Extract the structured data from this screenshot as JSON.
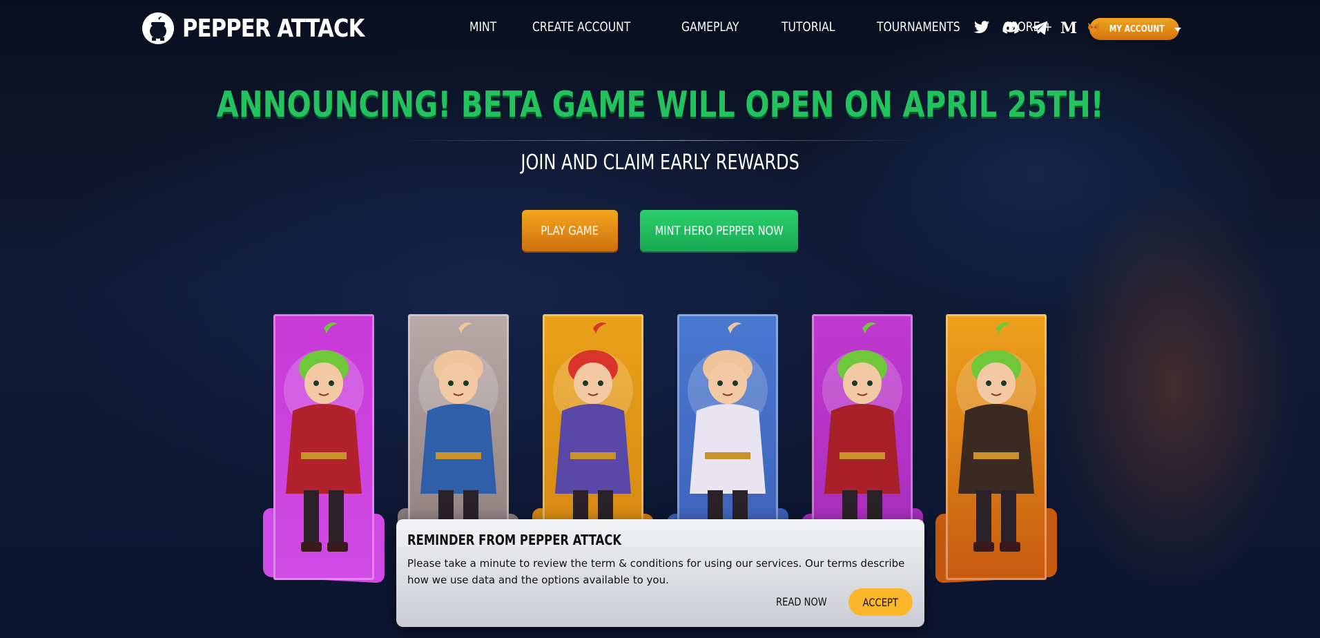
{
  "brand": {
    "name": "PEPPER ATTACK"
  },
  "nav": {
    "items": [
      "MINT",
      "CREATE ACCOUNT",
      "GAMEPLAY",
      "TUTORIAL",
      "TOURNAMENTS",
      "MORE +"
    ],
    "socials": [
      "twitter-icon",
      "discord-icon",
      "telegram-icon",
      "medium-icon"
    ],
    "account_label": "MY ACCOUNT"
  },
  "hero": {
    "headline": "ANNOUNCING! BETA GAME WILL OPEN ON APRIL 25TH!",
    "subline": "JOIN AND CLAIM EARLY REWARDS",
    "play_button": "PLAY GAME",
    "mint_button": "MINT HERO PEPPER NOW"
  },
  "cards": [
    {
      "name": "hero-card-red-swordsman",
      "panel": "#c83ad8",
      "base": "#d04ae6",
      "hair": "#6fc83a",
      "outfit": "#b3222c"
    },
    {
      "name": "hero-card-blue-knight",
      "panel": "#b8a8a8",
      "base": "#8a7a7a",
      "hair": "#f0c49a",
      "outfit": "#2e5fa8"
    },
    {
      "name": "hero-card-purple-warrior",
      "panel": "#e9a21a",
      "base": "#d28410",
      "hair": "#d8342a",
      "outfit": "#5a48a8"
    },
    {
      "name": "hero-card-white-mage",
      "panel": "#4a78d0",
      "base": "#3a5fb8",
      "hair": "#f0c49a",
      "outfit": "#e8e4f0"
    },
    {
      "name": "hero-card-crimson-noble",
      "panel": "#c03ad0",
      "base": "#a42ab8",
      "hair": "#6fc83a",
      "outfit": "#a8202a"
    },
    {
      "name": "hero-card-goggle-adventurer",
      "panel": "#eda21c",
      "base": "#c85a10",
      "hair": "#6fc83a",
      "outfit": "#3a2a22"
    }
  ],
  "dialog": {
    "title": "REMINDER FROM PEPPER ATTACK",
    "text": "Please take a minute to review the term & conditions for using our services. Our terms describe how we use data and the options available to you.",
    "read_label": "READ NOW",
    "accept_label": "ACCEPT"
  }
}
